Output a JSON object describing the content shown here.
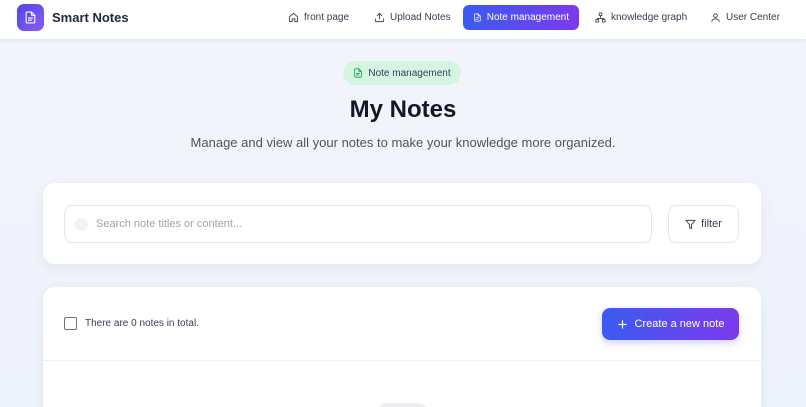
{
  "app": {
    "name": "Smart Notes",
    "logo_icon": "document-icon",
    "accent_start": "#3b5bf0",
    "accent_end": "#7c3aed"
  },
  "nav": {
    "items": [
      {
        "label": "front page",
        "icon": "home-icon",
        "active": false
      },
      {
        "label": "Upload Notes",
        "icon": "upload-icon",
        "active": false
      },
      {
        "label": "Note management",
        "icon": "document-icon",
        "active": true
      },
      {
        "label": "knowledge graph",
        "icon": "graph-icon",
        "active": false
      },
      {
        "label": "User Center",
        "icon": "user-icon",
        "active": false
      }
    ]
  },
  "hero": {
    "badge": "Note management",
    "title": "My Notes",
    "subtitle": "Manage and view all your notes to make your knowledge more organized."
  },
  "search": {
    "placeholder": "Search note titles or content...",
    "value": "",
    "filter_label": "filter"
  },
  "list": {
    "count_text": "There are 0 notes in total.",
    "select_all_checked": false,
    "create_label": "Create a new note"
  }
}
